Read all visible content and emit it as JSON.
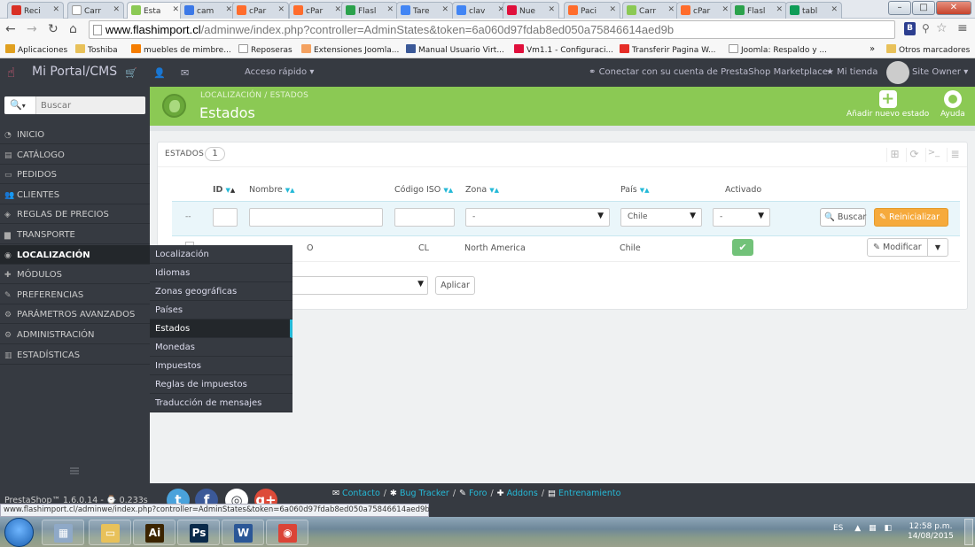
{
  "browser": {
    "tabs": [
      {
        "label": "Reci",
        "fav": "gmail-icon",
        "color": "#d93025",
        "active": false
      },
      {
        "label": "Carr",
        "fav": "page-icon",
        "color": "#ffffff",
        "active": false
      },
      {
        "label": "Esta",
        "fav": "prestashop-icon",
        "color": "#8bc954",
        "active": true
      },
      {
        "label": "cam",
        "fav": "google-plus-icon",
        "color": "#3b78e7",
        "active": false
      },
      {
        "label": "cPar",
        "fav": "cpanel-icon",
        "color": "#ff6c2c",
        "active": false
      },
      {
        "label": "cPar",
        "fav": "cpanel-icon",
        "color": "#ff6c2c",
        "active": false
      },
      {
        "label": "Flasl",
        "fav": "drive-icon",
        "color": "#2ba24c",
        "active": false
      },
      {
        "label": "Tare",
        "fav": "docs-icon",
        "color": "#4285f4",
        "active": false
      },
      {
        "label": "clav",
        "fav": "docs-icon",
        "color": "#4285f4",
        "active": false
      },
      {
        "label": "Nue",
        "fav": "w-icon",
        "color": "#e0103c",
        "active": false
      },
      {
        "label": "Paci",
        "fav": "cpanel-icon",
        "color": "#ff6c2c",
        "active": false
      },
      {
        "label": "Carr",
        "fav": "prestashop-icon",
        "color": "#8bc954",
        "active": false
      },
      {
        "label": "cPar",
        "fav": "cpanel-icon",
        "color": "#ff6c2c",
        "active": false
      },
      {
        "label": "Flasl",
        "fav": "drive-icon",
        "color": "#2ba24c",
        "active": false
      },
      {
        "label": "tabl",
        "fav": "sheets-icon",
        "color": "#0f9d58",
        "active": false
      }
    ],
    "url_domain": "www.flashimport.cl",
    "url_path": "/adminwe/index.php?controller=AdminStates&token=6a060d97fdab8ed050a75846614aed9b",
    "bookmarks": [
      {
        "label": "Aplicaciones",
        "icon": "apps-icon",
        "color": "#e0a020"
      },
      {
        "label": "Toshiba",
        "icon": "folder-icon",
        "color": "#e8c15a"
      },
      {
        "label": "muebles de mimbre...",
        "icon": "blogger-icon",
        "color": "#f57d00"
      },
      {
        "label": "Reposeras",
        "icon": "page-icon",
        "color": "#ffffff"
      },
      {
        "label": "Extensiones Joomla...",
        "icon": "joomla-icon",
        "color": "#f4a261"
      },
      {
        "label": "Manual Usuario Virt...",
        "icon": "book-icon",
        "color": "#3b5998"
      },
      {
        "label": "Vm1.1 - Configuraci...",
        "icon": "w-icon",
        "color": "#e0103c"
      },
      {
        "label": "Transferir Pagina W...",
        "icon": "youtube-icon",
        "color": "#e52d27"
      },
      {
        "label": "Joomla: Respaldo y ...",
        "icon": "page-icon",
        "color": "#ffffff"
      }
    ],
    "bookmarks_more": "»",
    "other_bookmarks": "Otros marcadores"
  },
  "topbar": {
    "brand": "Mi Portal/CMS",
    "quick_access": "Acceso rápido",
    "marketplace": "Conectar con su cuenta de PrestaShop Marketplace",
    "my_store": "Mi tienda",
    "owner": "Site Owner"
  },
  "sidebar": {
    "search_placeholder": "Buscar",
    "items": [
      {
        "label": "INICIO",
        "icon": "dashboard-icon",
        "active": false
      },
      {
        "label": "CATÁLOGO",
        "icon": "book-icon",
        "active": false
      },
      {
        "label": "PEDIDOS",
        "icon": "credit-card-icon",
        "active": false
      },
      {
        "label": "CLIENTES",
        "icon": "users-icon",
        "active": false
      },
      {
        "label": "REGLAS DE PRECIOS",
        "icon": "tag-icon",
        "active": false
      },
      {
        "label": "TRANSPORTE",
        "icon": "truck-icon",
        "active": false
      },
      {
        "label": "LOCALIZACIÓN",
        "icon": "globe-icon",
        "active": true
      },
      {
        "label": "MÓDULOS",
        "icon": "puzzle-icon",
        "active": false
      },
      {
        "label": "PREFERENCIAS",
        "icon": "wrench-icon",
        "active": false
      },
      {
        "label": "PARÁMETROS AVANZADOS",
        "icon": "cogs-icon",
        "active": false
      },
      {
        "label": "ADMINISTRACIÓN",
        "icon": "cog-icon",
        "active": false
      },
      {
        "label": "ESTADÍSTICAS",
        "icon": "bar-chart-icon",
        "active": false
      }
    ],
    "submenu": [
      {
        "label": "Localización",
        "active": false
      },
      {
        "label": "Idiomas",
        "active": false
      },
      {
        "label": "Zonas geográficas",
        "active": false
      },
      {
        "label": "Países",
        "active": false
      },
      {
        "label": "Estados",
        "active": true
      },
      {
        "label": "Monedas",
        "active": false
      },
      {
        "label": "Impuestos",
        "active": false
      },
      {
        "label": "Reglas de impuestos",
        "active": false
      },
      {
        "label": "Traducción de mensajes",
        "active": false
      }
    ]
  },
  "header": {
    "breadcrumb_parent": "LOCALIZACIÓN",
    "breadcrumb_sep": "/",
    "breadcrumb_current": "ESTADOS",
    "title": "Estados",
    "add_new": "Añadir nuevo estado",
    "help": "Ayuda"
  },
  "panel": {
    "title": "ESTADOS",
    "count": "1",
    "columns": {
      "id": "ID",
      "name": "Nombre",
      "iso": "Código ISO",
      "zone": "Zona",
      "country": "País",
      "active": "Activado"
    },
    "filters": {
      "dash": "--",
      "zone": "-",
      "country": "Chile",
      "active": "-"
    },
    "search_btn": "Buscar",
    "reset_btn": "Reinicializar",
    "row": {
      "iso": "CL",
      "zone": "North America",
      "country": "Chile",
      "active": true
    },
    "row_name_visible": "O",
    "edit_btn": "Modificar",
    "apply_btn": "Aplicar"
  },
  "footer": {
    "version": "PrestaShop™ 1.6.0.14 - ⌚ 0.233s",
    "links": [
      "Contacto",
      "Bug Tracker",
      "Foro",
      "Addons",
      "Entrenamiento"
    ],
    "link_sep": "/",
    "status_url": "www.flashimport.cl/adminwe/index.php?controller=AdminStates&token=6a060d97fdab8ed050a75846614aed9b"
  },
  "taskbar": {
    "apps": [
      {
        "name": "calculator",
        "icon": "calculator-icon",
        "color": "#8fa9c7",
        "glyph": "▦"
      },
      {
        "name": "explorer",
        "icon": "folder-icon",
        "color": "#e8c15a",
        "glyph": "▭"
      },
      {
        "name": "illustrator",
        "icon": "illustrator-icon",
        "color": "#3b2400",
        "glyph": "Ai"
      },
      {
        "name": "photoshop",
        "icon": "photoshop-icon",
        "color": "#0a2a4a",
        "glyph": "Ps"
      },
      {
        "name": "word",
        "icon": "word-icon",
        "color": "#2b5797",
        "glyph": "W"
      },
      {
        "name": "chrome",
        "icon": "chrome-icon",
        "color": "#db4437",
        "glyph": "◉"
      }
    ],
    "lang": "ES",
    "time": "12:58 p.m.",
    "date": "14/08/2015"
  }
}
